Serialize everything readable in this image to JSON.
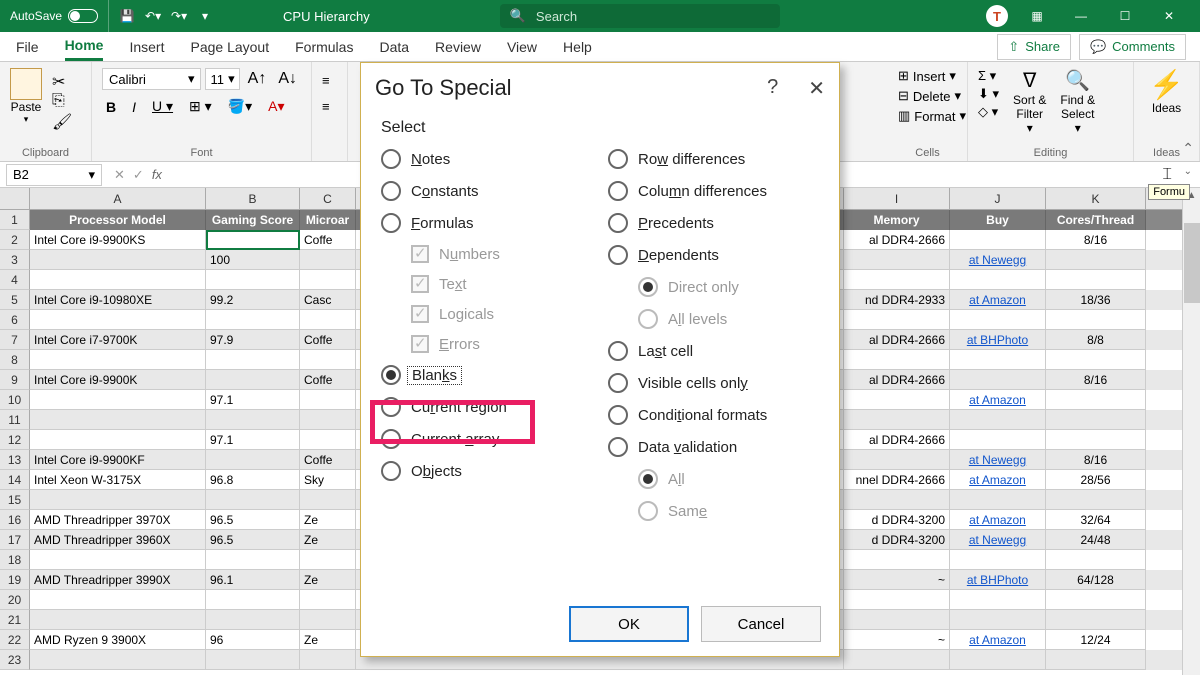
{
  "titlebar": {
    "autosave": "AutoSave",
    "doc_title": "CPU Hierarchy",
    "search_placeholder": "Search",
    "user_initial": "T"
  },
  "tabs": {
    "items": [
      "File",
      "Home",
      "Insert",
      "Page Layout",
      "Formulas",
      "Data",
      "Review",
      "View",
      "Help"
    ],
    "active_index": 1,
    "share": "Share",
    "comments": "Comments"
  },
  "ribbon": {
    "clipboard": {
      "paste": "Paste",
      "label": "Clipboard"
    },
    "font": {
      "name": "Calibri",
      "size": "11",
      "label": "Font"
    },
    "cells": {
      "insert": "Insert",
      "delete": "Delete",
      "format": "Format",
      "label": "Cells"
    },
    "editing": {
      "sort": "Sort &",
      "filter": "Filter",
      "find": "Find &",
      "select": "Select",
      "label": "Editing"
    },
    "ideas": {
      "label": "Ideas",
      "btn": "Ideas"
    }
  },
  "fxbar": {
    "namebox": "B2",
    "tooltip": "Formu"
  },
  "grid": {
    "col_letters": [
      "A",
      "B",
      "I",
      "J",
      "K"
    ],
    "headers": {
      "A": "Processor Model",
      "B": "Gaming Score",
      "C": "Microar",
      "I": "Memory",
      "J": "Buy",
      "K": "Cores/Thread"
    },
    "rows": [
      {
        "n": 2,
        "A": "Intel Core i9-9900KS",
        "B": "",
        "C": "Coffe",
        "I": "al DDR4-2666",
        "J": "",
        "K": "8/16"
      },
      {
        "n": 3,
        "A": "",
        "B": "100",
        "C": "",
        "I": "",
        "J": "at Newegg",
        "K": "",
        "shade": true
      },
      {
        "n": 4,
        "A": "",
        "B": "",
        "C": "",
        "I": "",
        "J": "",
        "K": ""
      },
      {
        "n": 5,
        "A": "Intel Core i9-10980XE",
        "B": "99.2",
        "C": "Casc",
        "I": "nd DDR4-2933",
        "J": "at Amazon",
        "K": "18/36",
        "shade": true
      },
      {
        "n": 6,
        "A": "",
        "B": "",
        "C": "",
        "I": "",
        "J": "",
        "K": ""
      },
      {
        "n": 7,
        "A": "Intel Core i7-9700K",
        "B": "97.9",
        "C": "Coffe",
        "I": "al DDR4-2666",
        "J": "at BHPhoto",
        "K": "8/8",
        "shade": true
      },
      {
        "n": 8,
        "A": "",
        "B": "",
        "C": "",
        "I": "",
        "J": "",
        "K": ""
      },
      {
        "n": 9,
        "A": "Intel Core i9-9900K",
        "B": "",
        "C": "Coffe",
        "I": "al DDR4-2666",
        "J": "",
        "K": "8/16",
        "shade": true
      },
      {
        "n": 10,
        "A": "",
        "B": "97.1",
        "C": "",
        "I": "",
        "J": "at Amazon",
        "K": ""
      },
      {
        "n": 11,
        "A": "",
        "B": "",
        "C": "",
        "I": "",
        "J": "",
        "K": "",
        "shade": true
      },
      {
        "n": 12,
        "A": "",
        "B": "97.1",
        "C": "",
        "I": "al DDR4-2666",
        "J": "",
        "K": ""
      },
      {
        "n": 13,
        "A": "Intel Core i9-9900KF",
        "B": "",
        "C": "Coffe",
        "I": "",
        "J": "at Newegg",
        "K": "8/16",
        "shade": true
      },
      {
        "n": 14,
        "A": "Intel Xeon W-3175X",
        "B": "96.8",
        "C": "Sky",
        "I": "nnel DDR4-2666",
        "J": "at Amazon",
        "K": "28/56"
      },
      {
        "n": 15,
        "A": "",
        "B": "",
        "C": "",
        "I": "",
        "J": "",
        "K": "",
        "shade": true
      },
      {
        "n": 16,
        "A": "AMD Threadripper 3970X",
        "B": "96.5",
        "C": "Ze",
        "I": "d DDR4-3200",
        "J": "at Amazon",
        "K": "32/64"
      },
      {
        "n": 17,
        "A": "AMD Threadripper 3960X",
        "B": "96.5",
        "C": "Ze",
        "I": "d DDR4-3200",
        "J": "at Newegg",
        "K": "24/48",
        "shade": true
      },
      {
        "n": 18,
        "A": "",
        "B": "",
        "C": "",
        "I": "",
        "J": "",
        "K": ""
      },
      {
        "n": 19,
        "A": "AMD Threadripper 3990X",
        "B": "96.1",
        "C": "Ze",
        "I": "~",
        "J": "at BHPhoto",
        "K": "64/128",
        "shade": true
      },
      {
        "n": 20,
        "A": "",
        "B": "",
        "C": "",
        "I": "",
        "J": "",
        "K": ""
      },
      {
        "n": 21,
        "A": "",
        "B": "",
        "C": "",
        "I": "",
        "J": "",
        "K": "",
        "shade": true
      },
      {
        "n": 22,
        "A": "AMD Ryzen 9 3900X",
        "B": "96",
        "C": "Ze",
        "I": "~",
        "J": "at Amazon",
        "K": "12/24"
      },
      {
        "n": 23,
        "A": "",
        "B": "",
        "C": "",
        "I": "",
        "J": "",
        "K": "",
        "shade": true
      }
    ]
  },
  "dialog": {
    "title": "Go To Special",
    "section": "Select",
    "left": [
      {
        "type": "radio",
        "label": "Notes",
        "u": "N"
      },
      {
        "type": "radio",
        "label": "Constants",
        "u": "o"
      },
      {
        "type": "radio",
        "label": "Formulas",
        "u": "F"
      },
      {
        "type": "check",
        "label": "Numbers",
        "u": "u",
        "on": true,
        "dis": true
      },
      {
        "type": "check",
        "label": "Text",
        "u": "x",
        "on": true,
        "dis": true
      },
      {
        "type": "check",
        "label": "Logicals",
        "u": "g",
        "on": true,
        "dis": true
      },
      {
        "type": "check",
        "label": "Errors",
        "u": "E",
        "on": true,
        "dis": true
      },
      {
        "type": "radio",
        "label": "Blanks",
        "u": "k",
        "selected": true,
        "dotted": true
      },
      {
        "type": "radio",
        "label": "Current region",
        "u": "r"
      },
      {
        "type": "radio",
        "label": "Current array",
        "u": "a"
      },
      {
        "type": "radio",
        "label": "Objects",
        "u": "b"
      }
    ],
    "right": [
      {
        "type": "radio",
        "label": "Row differences",
        "u": "w"
      },
      {
        "type": "radio",
        "label": "Column differences",
        "u": "m"
      },
      {
        "type": "radio",
        "label": "Precedents",
        "u": "P"
      },
      {
        "type": "radio",
        "label": "Dependents",
        "u": "D"
      },
      {
        "type": "subradio",
        "label": "Direct only",
        "u": "I",
        "dis": true,
        "selected": true
      },
      {
        "type": "subradio",
        "label": "All levels",
        "u": "l",
        "dis": true
      },
      {
        "type": "radio",
        "label": "Last cell",
        "u": "s"
      },
      {
        "type": "radio",
        "label": "Visible cells only",
        "u": "y"
      },
      {
        "type": "radio",
        "label": "Conditional formats",
        "u": "t"
      },
      {
        "type": "radio",
        "label": "Data validation",
        "u": "v"
      },
      {
        "type": "subradio",
        "label": "All",
        "u": "l",
        "dis": true,
        "selected": true
      },
      {
        "type": "subradio",
        "label": "Same",
        "u": "e",
        "dis": true
      }
    ],
    "ok": "OK",
    "cancel": "Cancel"
  }
}
